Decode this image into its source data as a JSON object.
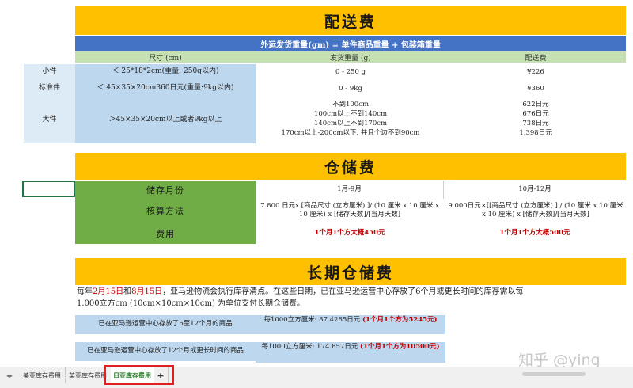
{
  "shipping": {
    "title": "配送费",
    "formula": "外运发货重量(gm) = 单件商品重量 + 包装箱重量",
    "headers": [
      "尺寸 (cm)",
      "发货重量 (g)",
      "配送费"
    ],
    "rows": [
      {
        "label": "小件",
        "size": "＜ 25*18*2cm(重量: 250g以内)",
        "weight": "0 - 250 g",
        "fee": "¥226"
      },
      {
        "label": "标准件",
        "size": "＜ 45×35×20cm360日元(重量:9kg以内)",
        "weight": "0 - 9kg",
        "fee": "¥360"
      },
      {
        "label": "大件",
        "size": "＞45×35×20cm以上或者9kg以上",
        "weights": [
          "不到100cm",
          "100cm以上不到140cm",
          "140cm以上不到170cm",
          "170cm以上-200cm以下, 并且个边不到90cm"
        ],
        "fees": [
          "622日元",
          "676日元",
          "738日元",
          "1,398日元"
        ]
      }
    ]
  },
  "storage": {
    "title": "仓储费",
    "row_labels": [
      "储存月份",
      "核算方法",
      "费用"
    ],
    "col1": {
      "month": "1月-9月",
      "method": "7.800 日元x [商品尺寸 (立方厘米) ]/ (10 厘米 x 10 厘米 x 10 厘米) x [储存天数]/[当月天数]",
      "fee": "1个月1个方大概450元"
    },
    "col2": {
      "month": "10月-12月",
      "method": "9.000日元×[[商品尺寸 (立方厘米) ] / (10 厘米 x 10 厘米 x 10 厘米) x [储存天数]/[当月天数]",
      "fee": "1个月1个方大概500元"
    }
  },
  "longterm": {
    "title": "长期仓储费",
    "para_a": "每年",
    "date1": "2月15日",
    "para_b": "和",
    "date2": "8月15日",
    "para_c": "，亚马逊物流会执行库存清点。在这些日期，已在亚马逊运营中心存放了6个月或更长时间的库存需以每",
    "para_line2": "1.000立方cm (10cm×10cm×10cm) 为单位支付长期仓储费。",
    "rows": [
      {
        "label": "已在亚马逊运营中心存放了6至12个月的商品",
        "fee": "每1000立方厘米: 87.4285日元",
        "note": "(1个月1个方为5245元)"
      },
      {
        "label": "已在亚马逊运营中心存放了12个月或更长时间的商品",
        "fee": "每1000立方厘米: 174.857日元",
        "note": "(1个月1个方为10500元)"
      }
    ]
  },
  "watermark": "知乎 @ying",
  "tabs": [
    "美亚库存费用",
    "英亚库存费用",
    "日亚库存费用"
  ],
  "add_tab": "+",
  "colors": {
    "band": "#ffc000",
    "blue": "#4472c4",
    "green": "#70ad47",
    "red": "#c00000"
  }
}
